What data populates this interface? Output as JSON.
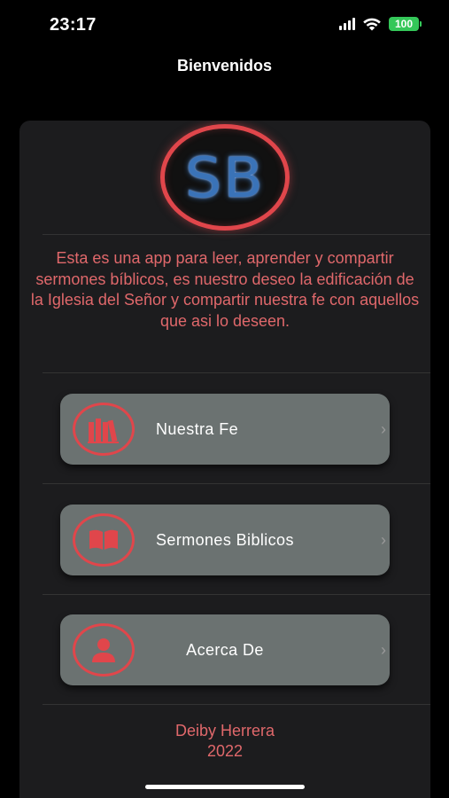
{
  "status_bar": {
    "time": "23:17",
    "battery": "100",
    "battery_color": "#34c759"
  },
  "nav": {
    "title": "Bienvenidos"
  },
  "logo": {
    "text": "SB",
    "ring_color": "#e0464b",
    "text_color": "#3a73b8"
  },
  "intro": {
    "text": "Esta es una app para leer, aprender y compartir sermones bíblicos, es nuestro deseo la edificación de la Iglesia del Señor y compartir nuestra fe con aquellos que asi lo deseen."
  },
  "menu": {
    "items": [
      {
        "label": "Nuestra Fe",
        "icon": "books-icon"
      },
      {
        "label": "Sermones Biblicos",
        "icon": "open-book-icon"
      },
      {
        "label": "Acerca De",
        "icon": "person-icon"
      }
    ],
    "chevron": "›"
  },
  "footer": {
    "author": "Deiby Herrera",
    "year": "2022"
  },
  "colors": {
    "accent": "#e0464b",
    "text_accent": "#e0686b",
    "button_bg": "#6b7271",
    "card_bg": "#1c1c1e"
  }
}
